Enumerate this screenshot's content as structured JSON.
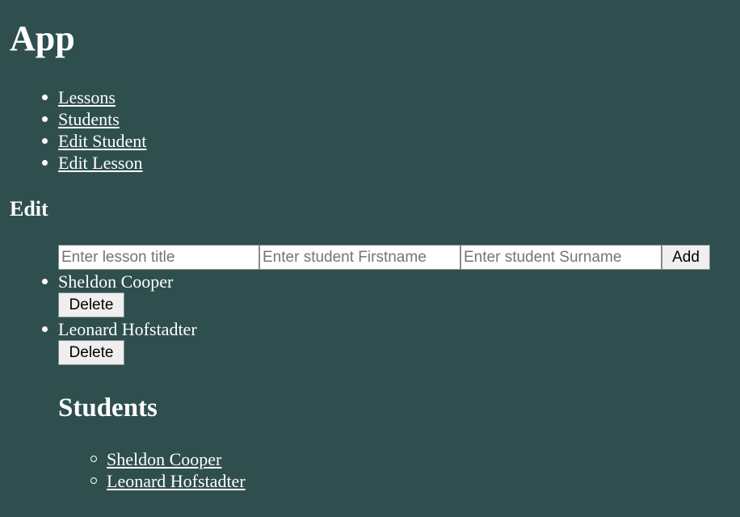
{
  "app": {
    "title": "App"
  },
  "nav": {
    "items": [
      {
        "label": "Lessons"
      },
      {
        "label": "Students"
      },
      {
        "label": "Edit Student"
      },
      {
        "label": "Edit Lesson"
      }
    ]
  },
  "edit": {
    "heading": "Edit",
    "form": {
      "lesson_title_placeholder": "Enter lesson title",
      "firstname_placeholder": "Enter student Firstname",
      "surname_placeholder": "Enter student Surname",
      "add_label": "Add"
    },
    "students": [
      {
        "name": "Sheldon Cooper",
        "delete_label": "Delete"
      },
      {
        "name": "Leonard Hofstadter",
        "delete_label": "Delete"
      }
    ]
  },
  "students_section": {
    "heading": "Students",
    "links": [
      {
        "label": "Sheldon Cooper"
      },
      {
        "label": "Leonard Hofstadter"
      }
    ]
  },
  "colors": {
    "background": "#2f4f4f",
    "text": "#ffffff"
  }
}
